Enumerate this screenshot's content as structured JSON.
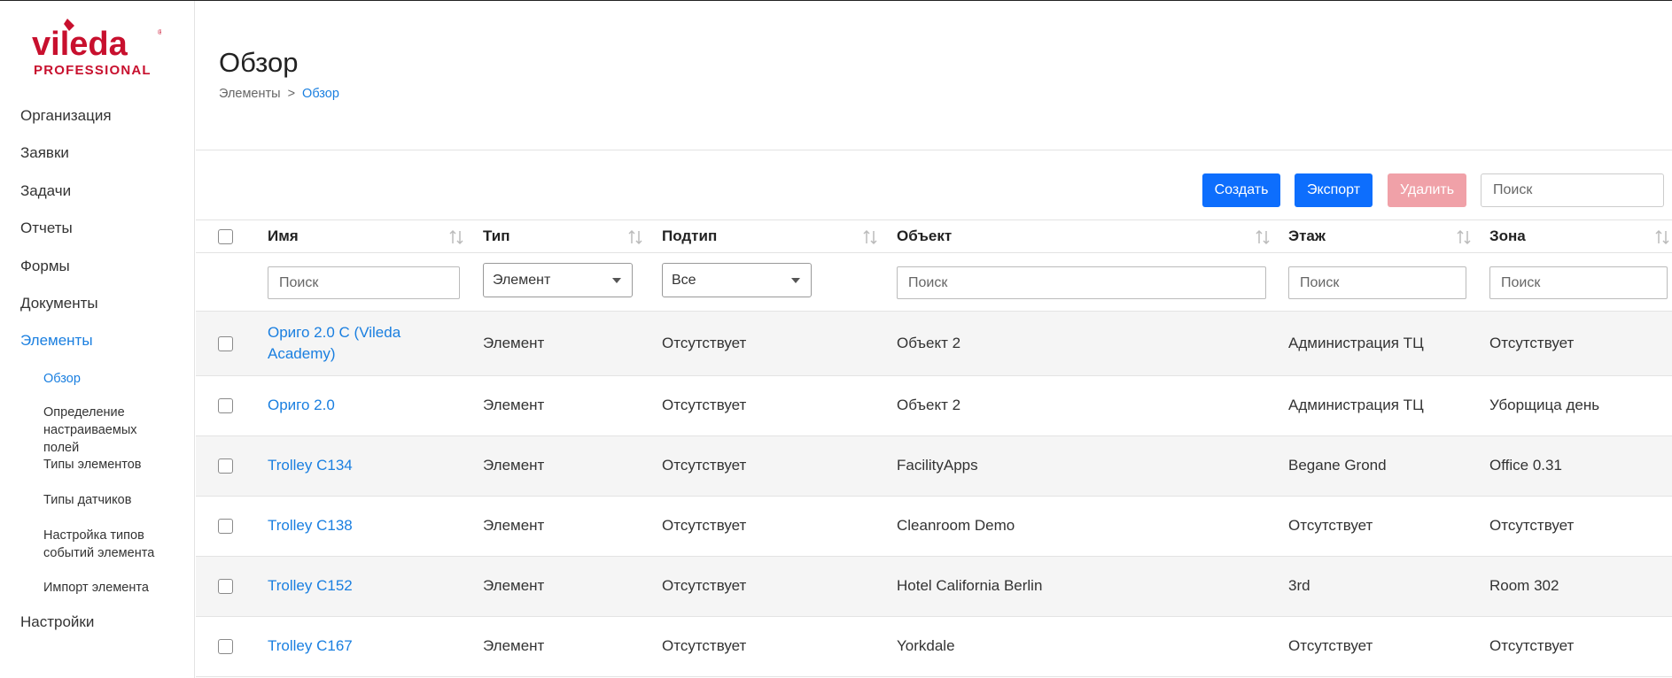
{
  "brand": {
    "logo_text": "vileda",
    "logo_subtext": "PROFESSIONAL",
    "color": "#c8102e"
  },
  "sidebar": {
    "items": [
      {
        "label": "Организация"
      },
      {
        "label": "Заявки"
      },
      {
        "label": "Задачи"
      },
      {
        "label": "Отчеты"
      },
      {
        "label": "Формы"
      },
      {
        "label": "Документы"
      },
      {
        "label": "Элементы",
        "active": true
      }
    ],
    "subitems": [
      {
        "label": "Обзор",
        "active": true
      },
      {
        "label": "Определение настраиваемых полей"
      },
      {
        "label": "Типы элементов"
      },
      {
        "label": "Типы датчиков"
      },
      {
        "label": "Настройка типов событий элемента"
      },
      {
        "label": "Импорт элемента"
      }
    ],
    "settings_label": "Настройки"
  },
  "header": {
    "title": "Обзор",
    "breadcrumb": {
      "parent": "Элементы",
      "separator": ">",
      "current": "Обзор"
    }
  },
  "toolbar": {
    "create_label": "Создать",
    "export_label": "Экспорт",
    "delete_label": "Удалить",
    "search_placeholder": "Поиск"
  },
  "table": {
    "columns": [
      "Имя",
      "Тип",
      "Подтип",
      "Объект",
      "Этаж",
      "Зона"
    ],
    "filters": {
      "name_placeholder": "Поиск",
      "type_value": "Элемент",
      "subtype_value": "Все",
      "object_placeholder": "Поиск",
      "floor_placeholder": "Поиск",
      "zone_placeholder": "Поиск"
    },
    "rows": [
      {
        "name": "Ориго 2.0 C (Vileda Academy)",
        "type": "Элемент",
        "subtype": "Отсутствует",
        "object": "Объект 2",
        "floor": "Администрация ТЦ",
        "zone": "Отсутствует"
      },
      {
        "name": "Ориго 2.0",
        "type": "Элемент",
        "subtype": "Отсутствует",
        "object": "Объект 2",
        "floor": "Администрация ТЦ",
        "zone": "Уборщица день"
      },
      {
        "name": "Trolley C134",
        "type": "Элемент",
        "subtype": "Отсутствует",
        "object": "FacilityApps",
        "floor": "Begane Grond",
        "zone": "Office 0.31"
      },
      {
        "name": "Trolley C138",
        "type": "Элемент",
        "subtype": "Отсутствует",
        "object": "Cleanroom Demo",
        "floor": "Отсутствует",
        "zone": "Отсутствует"
      },
      {
        "name": "Trolley C152",
        "type": "Элемент",
        "subtype": "Отсутствует",
        "object": "Hotel California Berlin",
        "floor": "3rd",
        "zone": "Room 302"
      },
      {
        "name": "Trolley C167",
        "type": "Элемент",
        "subtype": "Отсутствует",
        "object": "Yorkdale",
        "floor": "Отсутствует",
        "zone": "Отсутствует"
      }
    ]
  },
  "colors": {
    "primary": "#0d6efd",
    "link": "#1a7fe0",
    "danger_disabled": "#f0a1a8"
  }
}
